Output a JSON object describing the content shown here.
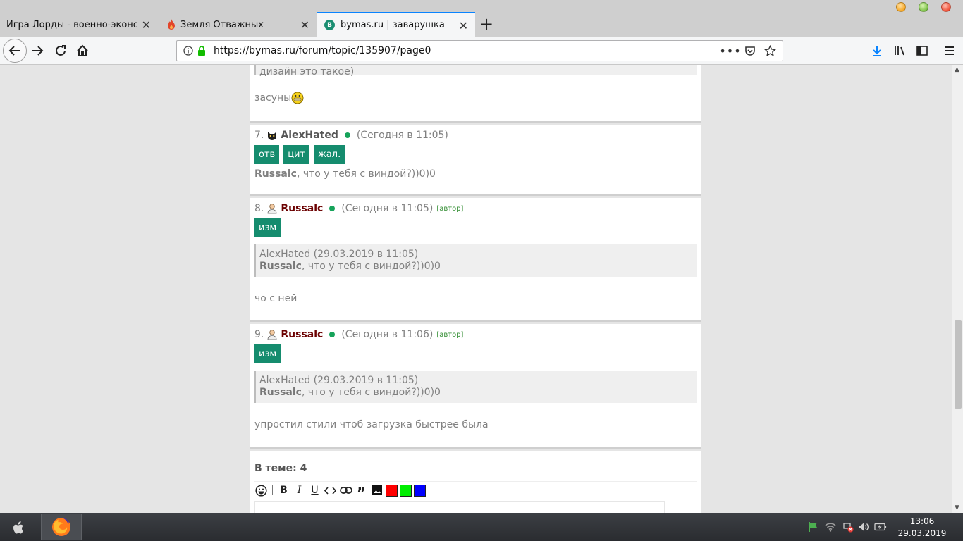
{
  "browser": {
    "tabs": [
      {
        "title": "Игра Лорды - военно-экономи",
        "active": false
      },
      {
        "title": "Земля Отважных",
        "active": false
      },
      {
        "title": "bymas.ru | заварушка",
        "active": true,
        "favicon_letter": "B"
      }
    ],
    "url": "https://bymas.ru/forum/topic/135907/page0",
    "accent_color": "#0a84ff"
  },
  "page": {
    "accent_color": "#158c6e",
    "partial_post": {
      "quote_text": "дизайн это такое)",
      "text": "засуны",
      "smiley": "grin-smiley-icon"
    },
    "posts": [
      {
        "num": "7.",
        "avatar": "black-cat-avatar-icon",
        "username": "AlexHated",
        "time": "(Сегодня в 11:05)",
        "buttons": [
          "отв",
          "цит",
          "жал."
        ],
        "text_bold": "Russalc",
        "text_rest": ", что у тебя с виндой?))0)0"
      },
      {
        "num": "8.",
        "avatar": "user-avatar-icon",
        "username": "Russalc",
        "time": "(Сегодня в 11:05)",
        "badge": "[автор]",
        "buttons": [
          "изм"
        ],
        "quote_header": "AlexHated (29.03.2019 в 11:05)",
        "quote_bold": "Russalc",
        "quote_rest": ", что у тебя с виндой?))0)0",
        "text": "чо с ней"
      },
      {
        "num": "9.",
        "avatar": "user-avatar-icon",
        "username": "Russalc",
        "time": "(Сегодня в 11:06)",
        "badge": "[автор]",
        "buttons": [
          "изм"
        ],
        "quote_header": "AlexHated (29.03.2019 в 11:05)",
        "quote_bold": "Russalc",
        "quote_rest": ", что у тебя с виндой?))0)0",
        "text": "упростил стили чтоб загрузка быстрее была"
      }
    ],
    "topic_count_label": "В теме: 4",
    "editor": {
      "bold_label": "B",
      "italic_label": "I",
      "underline_label": "U",
      "colors": [
        "#ff0000",
        "#00ee00",
        "#0000ff"
      ]
    }
  },
  "taskbar": {
    "time": "13:06",
    "date": "29.03.2019"
  }
}
